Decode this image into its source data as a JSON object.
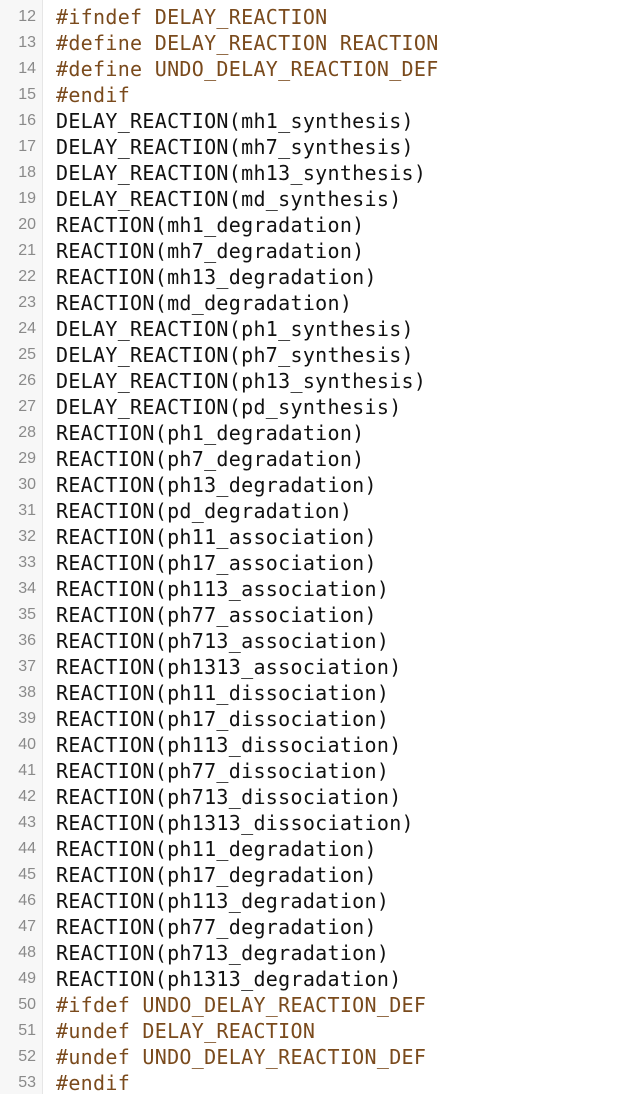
{
  "colors": {
    "preprocessor": "#7a4a1c",
    "code": "#111111",
    "line_number": "#8a8a8a",
    "gutter_background": "#f7f7f7"
  },
  "lines": [
    {
      "n": "12",
      "text": "#ifndef DELAY_REACTION",
      "kind": "preprocessor"
    },
    {
      "n": "13",
      "text": "#define DELAY_REACTION REACTION",
      "kind": "preprocessor"
    },
    {
      "n": "14",
      "text": "#define UNDO_DELAY_REACTION_DEF",
      "kind": "preprocessor"
    },
    {
      "n": "15",
      "text": "#endif",
      "kind": "preprocessor"
    },
    {
      "n": "16",
      "text": "DELAY_REACTION(mh1_synthesis)",
      "kind": "code"
    },
    {
      "n": "17",
      "text": "DELAY_REACTION(mh7_synthesis)",
      "kind": "code"
    },
    {
      "n": "18",
      "text": "DELAY_REACTION(mh13_synthesis)",
      "kind": "code"
    },
    {
      "n": "19",
      "text": "DELAY_REACTION(md_synthesis)",
      "kind": "code"
    },
    {
      "n": "20",
      "text": "REACTION(mh1_degradation)",
      "kind": "code"
    },
    {
      "n": "21",
      "text": "REACTION(mh7_degradation)",
      "kind": "code"
    },
    {
      "n": "22",
      "text": "REACTION(mh13_degradation)",
      "kind": "code"
    },
    {
      "n": "23",
      "text": "REACTION(md_degradation)",
      "kind": "code"
    },
    {
      "n": "24",
      "text": "DELAY_REACTION(ph1_synthesis)",
      "kind": "code"
    },
    {
      "n": "25",
      "text": "DELAY_REACTION(ph7_synthesis)",
      "kind": "code"
    },
    {
      "n": "26",
      "text": "DELAY_REACTION(ph13_synthesis)",
      "kind": "code"
    },
    {
      "n": "27",
      "text": "DELAY_REACTION(pd_synthesis)",
      "kind": "code"
    },
    {
      "n": "28",
      "text": "REACTION(ph1_degradation)",
      "kind": "code"
    },
    {
      "n": "29",
      "text": "REACTION(ph7_degradation)",
      "kind": "code"
    },
    {
      "n": "30",
      "text": "REACTION(ph13_degradation)",
      "kind": "code"
    },
    {
      "n": "31",
      "text": "REACTION(pd_degradation)",
      "kind": "code"
    },
    {
      "n": "32",
      "text": "REACTION(ph11_association)",
      "kind": "code"
    },
    {
      "n": "33",
      "text": "REACTION(ph17_association)",
      "kind": "code"
    },
    {
      "n": "34",
      "text": "REACTION(ph113_association)",
      "kind": "code"
    },
    {
      "n": "35",
      "text": "REACTION(ph77_association)",
      "kind": "code"
    },
    {
      "n": "36",
      "text": "REACTION(ph713_association)",
      "kind": "code"
    },
    {
      "n": "37",
      "text": "REACTION(ph1313_association)",
      "kind": "code"
    },
    {
      "n": "38",
      "text": "REACTION(ph11_dissociation)",
      "kind": "code"
    },
    {
      "n": "39",
      "text": "REACTION(ph17_dissociation)",
      "kind": "code"
    },
    {
      "n": "40",
      "text": "REACTION(ph113_dissociation)",
      "kind": "code"
    },
    {
      "n": "41",
      "text": "REACTION(ph77_dissociation)",
      "kind": "code"
    },
    {
      "n": "42",
      "text": "REACTION(ph713_dissociation)",
      "kind": "code"
    },
    {
      "n": "43",
      "text": "REACTION(ph1313_dissociation)",
      "kind": "code"
    },
    {
      "n": "44",
      "text": "REACTION(ph11_degradation)",
      "kind": "code"
    },
    {
      "n": "45",
      "text": "REACTION(ph17_degradation)",
      "kind": "code"
    },
    {
      "n": "46",
      "text": "REACTION(ph113_degradation)",
      "kind": "code"
    },
    {
      "n": "47",
      "text": "REACTION(ph77_degradation)",
      "kind": "code"
    },
    {
      "n": "48",
      "text": "REACTION(ph713_degradation)",
      "kind": "code"
    },
    {
      "n": "49",
      "text": "REACTION(ph1313_degradation)",
      "kind": "code"
    },
    {
      "n": "50",
      "text": "#ifdef UNDO_DELAY_REACTION_DEF",
      "kind": "preprocessor"
    },
    {
      "n": "51",
      "text": "#undef DELAY_REACTION",
      "kind": "preprocessor"
    },
    {
      "n": "52",
      "text": "#undef UNDO_DELAY_REACTION_DEF",
      "kind": "preprocessor"
    },
    {
      "n": "53",
      "text": "#endif",
      "kind": "preprocessor"
    }
  ]
}
